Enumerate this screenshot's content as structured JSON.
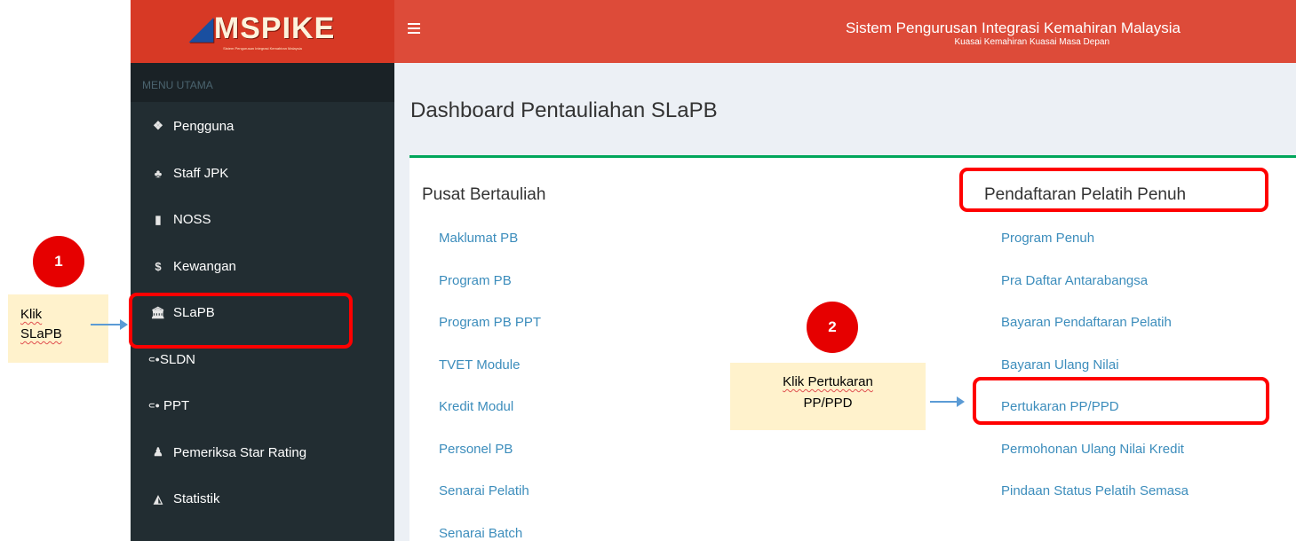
{
  "app": {
    "logo_text": "MSPIKE",
    "logo_tagline": "Sistem Pengurusan Integrasi Kemahiran Malaysia",
    "system_title": "Sistem Pengurusan Integrasi Kemahiran Malaysia",
    "system_subtitle": "Kuasai Kemahiran Kuasai Masa Depan"
  },
  "sidebar": {
    "header": "MENU UTAMA",
    "items": [
      {
        "label": "Pengguna",
        "icon": "users-icon"
      },
      {
        "label": "Staff JPK",
        "icon": "sitemap-icon"
      },
      {
        "label": "NOSS",
        "icon": "file-icon"
      },
      {
        "label": "Kewangan",
        "icon": "dollar-icon"
      },
      {
        "label": "SLaPB",
        "icon": "bank-icon"
      },
      {
        "label": "SLDN",
        "icon": "sldn-logo-icon"
      },
      {
        "label": "PPT",
        "icon": "ppt-logo-icon"
      },
      {
        "label": "Pemeriksa Star Rating",
        "icon": "user-secret-icon"
      },
      {
        "label": "Statistik",
        "icon": "area-chart-icon"
      }
    ]
  },
  "main": {
    "title": "Dashboard Pentauliahan SLaPB",
    "left_column": {
      "title": "Pusat Bertauliah",
      "links": [
        "Maklumat PB",
        "Program PB",
        "Program PB PPT",
        "TVET Module",
        "Kredit Modul",
        "Personel PB",
        "Senarai Pelatih",
        "Senarai Batch"
      ]
    },
    "right_column": {
      "title": "Pendaftaran Pelatih Penuh",
      "links": [
        "Program Penuh",
        "Pra Daftar Antarabangsa",
        "Bayaran Pendaftaran Pelatih",
        "Bayaran Ulang Nilai",
        "Pertukaran PP/PPD",
        "Permohonan Ulang Nilai Kredit",
        "Pindaan Status Pelatih Semasa"
      ]
    }
  },
  "annotations": {
    "step1_number": "1",
    "step1_note_line1": "Klik",
    "step1_note_line2": "SLaPB",
    "step2_number": "2",
    "step2_note_line1": "Klik Pertukaran",
    "step2_note_line2": "PP/PPD",
    "highlight_color": "#ff0000",
    "badge_color": "#e60000",
    "note_color": "#fff2cc"
  },
  "colors": {
    "header_red": "#dd4b39",
    "logo_red": "#d73925",
    "sidebar_dark": "#222d32",
    "link_blue": "#3c8dbc",
    "box_border_green": "#00a65a"
  }
}
